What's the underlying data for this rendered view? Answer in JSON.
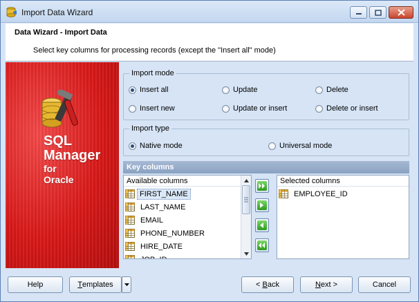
{
  "window": {
    "title": "Import Data Wizard"
  },
  "header": {
    "title": "Data Wizard - Import Data",
    "subtitle": "Select key columns for processing records (except the \"Insert all\" mode)"
  },
  "banner": {
    "line1": "SQL",
    "line2": "Manager",
    "line3": "for",
    "line4": "Oracle",
    "accent_color": "#d81818"
  },
  "import_mode": {
    "label": "Import mode",
    "options": [
      {
        "label": "Insert all",
        "checked": true
      },
      {
        "label": "Update",
        "checked": false
      },
      {
        "label": "Delete",
        "checked": false
      },
      {
        "label": "Insert new",
        "checked": false
      },
      {
        "label": "Update or insert",
        "checked": false
      },
      {
        "label": "Delete or insert",
        "checked": false
      }
    ]
  },
  "import_type": {
    "label": "Import type",
    "options": [
      {
        "label": "Native mode",
        "checked": true
      },
      {
        "label": "Universal mode",
        "checked": false
      }
    ]
  },
  "key_columns": {
    "title": "Key columns",
    "available": {
      "header": "Available columns",
      "items": [
        "FIRST_NAME",
        "LAST_NAME",
        "EMAIL",
        "PHONE_NUMBER",
        "HIRE_DATE",
        "JOB_ID"
      ],
      "selected_index": 0
    },
    "selected": {
      "header": "Selected columns",
      "items": [
        "EMPLOYEE_ID"
      ]
    },
    "buttons": [
      "move-all-right-icon",
      "move-right-icon",
      "move-left-icon",
      "move-all-left-icon"
    ]
  },
  "footer": {
    "help": "Help",
    "templates": "Templates",
    "back": "< Back",
    "next": "Next >",
    "cancel": "Cancel"
  }
}
